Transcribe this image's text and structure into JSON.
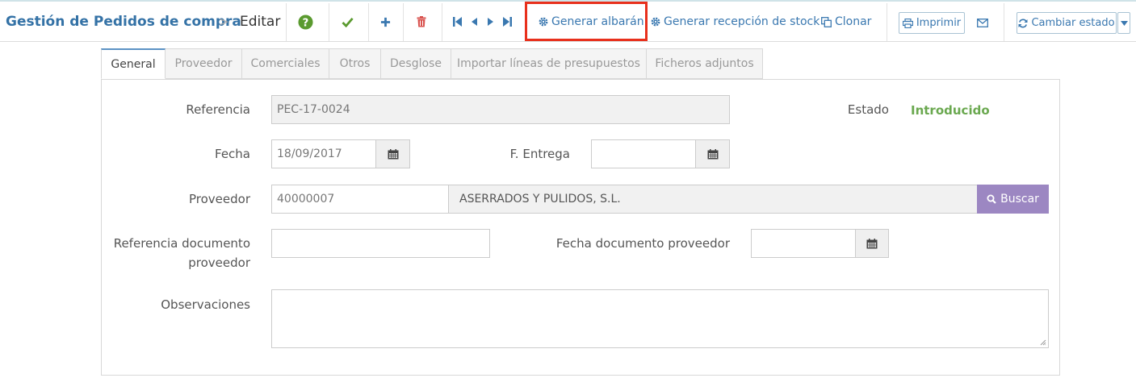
{
  "header": {
    "title": "Gestión de Pedidos de compra",
    "separator": ">",
    "current": "Editar"
  },
  "toolbar": {
    "icons": [
      "help-icon",
      "check-icon",
      "plus-icon",
      "trash-icon",
      "first-icon",
      "prev-icon",
      "next-icon",
      "last-icon"
    ],
    "generate_delivery_label": "Generar albarán",
    "generate_stock_label": "Generar recepción de stock",
    "clone_label": "Clonar",
    "print_label": "Imprimir",
    "change_status_label": "Cambiar estado"
  },
  "tabs": [
    {
      "label": "General",
      "active": true
    },
    {
      "label": "Proveedor",
      "active": false
    },
    {
      "label": "Comerciales",
      "active": false
    },
    {
      "label": "Otros",
      "active": false
    },
    {
      "label": "Desglose",
      "active": false
    },
    {
      "label": "Importar líneas de presupuestos",
      "active": false
    },
    {
      "label": "Ficheros adjuntos",
      "active": false
    }
  ],
  "form": {
    "referencia_label": "Referencia",
    "referencia_value": "PEC-17-0024",
    "estado_label": "Estado",
    "estado_value": "Introducido",
    "fecha_label": "Fecha",
    "fecha_value": "18/09/2017",
    "entrega_label": "F. Entrega",
    "entrega_value": "",
    "proveedor_label": "Proveedor",
    "proveedor_code": "40000007",
    "proveedor_name": "ASERRADOS Y PULIDOS, S.L.",
    "buscar_label": "Buscar",
    "ref_doc_label_1": "Referencia documento",
    "ref_doc_label_2": "proveedor",
    "ref_doc_value": "",
    "fecha_doc_label": "Fecha documento proveedor",
    "fecha_doc_value": "",
    "observaciones_label": "Observaciones",
    "observaciones_value": ""
  },
  "colors": {
    "title": "#3472a6",
    "link": "#3a78b0",
    "status": "#6aa84f",
    "buscar_bg": "#9c87c2",
    "highlight": "#e8301c",
    "help": "#5a9a2f",
    "check": "#5a9a2f",
    "plus": "#3a78b0",
    "trash": "#d9534f"
  }
}
